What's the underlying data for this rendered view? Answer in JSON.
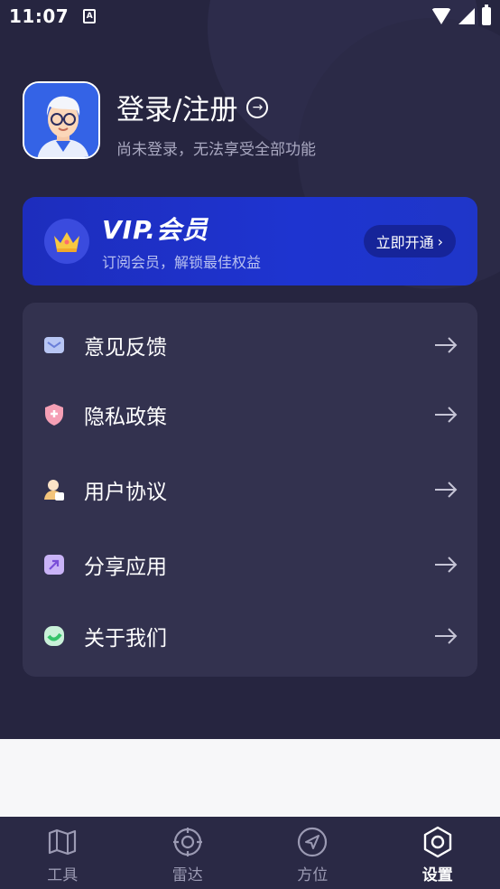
{
  "status_bar": {
    "time": "11:07",
    "notification_icon": "A"
  },
  "profile": {
    "title": "登录/注册",
    "subtitle": "尚未登录，无法享受全部功能",
    "avatar_icon": "user-avatar-icon"
  },
  "vip": {
    "title": "VIP.会员",
    "subtitle": "订阅会员，解锁最佳权益",
    "button_label": "立即开通",
    "icon": "crown-icon",
    "accent": "#1e34d0"
  },
  "menu": {
    "items": [
      {
        "label": "意见反馈",
        "icon": "mail-icon"
      },
      {
        "label": "隐私政策",
        "icon": "shield-icon"
      },
      {
        "label": "用户协议",
        "icon": "user-agreement-icon"
      },
      {
        "label": "分享应用",
        "icon": "share-icon"
      },
      {
        "label": "关于我们",
        "icon": "about-icon"
      }
    ]
  },
  "bottom_nav": {
    "items": [
      {
        "label": "工具",
        "icon": "map-tool-icon"
      },
      {
        "label": "雷达",
        "icon": "radar-icon"
      },
      {
        "label": "方位",
        "icon": "compass-icon"
      },
      {
        "label": "设置",
        "icon": "settings-icon"
      }
    ],
    "active_index": 3
  }
}
